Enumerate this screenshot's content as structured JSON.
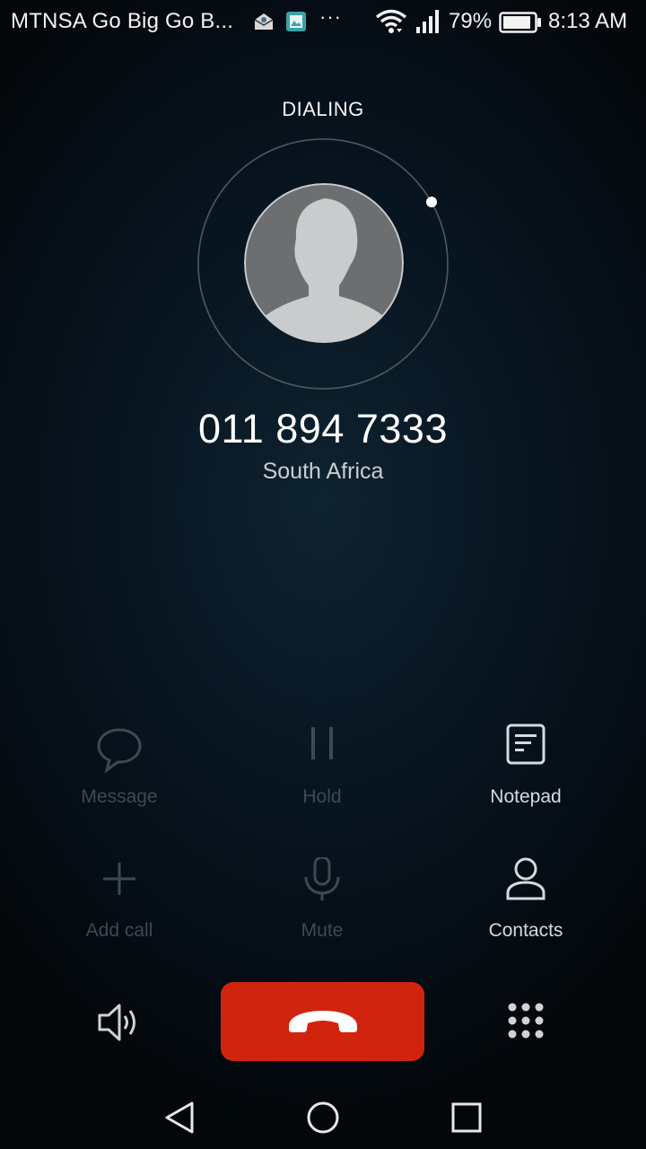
{
  "status_bar": {
    "carrier": "MTNSA Go Big Go B...",
    "more_dots": "···",
    "battery_percent": "79%",
    "time": "8:13 AM",
    "icons": [
      "mail-notification-icon",
      "gallery-notification-icon",
      "wifi-icon",
      "signal-icon",
      "battery-icon"
    ]
  },
  "call": {
    "state": "DIALING",
    "number": "011 894 7333",
    "location": "South Africa"
  },
  "actions": [
    {
      "label": "Message",
      "icon": "message-icon",
      "enabled": false
    },
    {
      "label": "Hold",
      "icon": "pause-icon",
      "enabled": false
    },
    {
      "label": "Notepad",
      "icon": "notepad-icon",
      "enabled": true
    },
    {
      "label": "Add call",
      "icon": "plus-icon",
      "enabled": false
    },
    {
      "label": "Mute",
      "icon": "microphone-icon",
      "enabled": false
    },
    {
      "label": "Contacts",
      "icon": "person-icon",
      "enabled": true
    }
  ],
  "controls": {
    "speaker_icon": "speaker-icon",
    "end_call_icon": "hang-up-icon",
    "dialpad_icon": "dialpad-icon"
  },
  "nav": {
    "back_icon": "back-triangle-icon",
    "home_icon": "home-circle-icon",
    "recents_icon": "recents-square-icon"
  },
  "colors": {
    "end_call": "#d1240f",
    "disabled_action": "#3d4a53",
    "enabled_action": "#d6dadd"
  }
}
